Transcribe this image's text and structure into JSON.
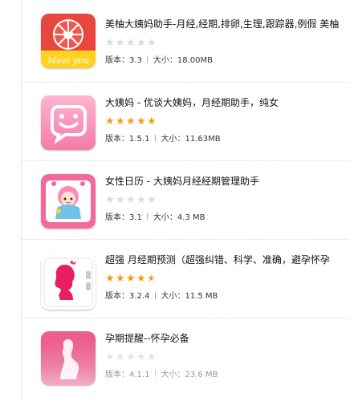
{
  "apps": [
    {
      "title": "美柚大姨妈助手-月经,经期,排卵,生理,跟踪器,例假 美柚",
      "stars": [
        0,
        0,
        0,
        0,
        0
      ],
      "version_label": "版本：",
      "version": "3.3",
      "size_label": "大小：",
      "size": "18.00MB",
      "icon": "meetyou-grapefruit-icon",
      "icon_text": "Meet you"
    },
    {
      "title": "大姨妈 - 优谈大姨妈，月经期助手，纯女",
      "stars": [
        1,
        1,
        1,
        1,
        1
      ],
      "version_label": "版本：",
      "version": "1.5.1",
      "size_label": "大小：",
      "size": "11.63MB",
      "icon": "smiley-speech-bubble-icon"
    },
    {
      "title": "女性日历 - 大姨妈月经经期管理助手",
      "stars": [
        0,
        0,
        0,
        0,
        0
      ],
      "version_label": "版本：",
      "version": "3.1",
      "size_label": "大小：",
      "size": "4.3 MB",
      "icon": "cartoon-girl-calendar-icon"
    },
    {
      "title": "超强 月经期预测（超强纠错、科学、准确，避孕怀孕",
      "stars": [
        1,
        1,
        1,
        1,
        0.5
      ],
      "version_label": "版本：",
      "version": "3.2.4",
      "size_label": "大小：",
      "size": "11.5 MB",
      "icon": "woman-silhouette-notebook-icon"
    },
    {
      "title": "孕期提醒--怀孕必备",
      "stars": [
        0,
        0,
        0,
        0,
        0
      ],
      "version_label": "版本：",
      "version": "4.1.1",
      "size_label": "大小：",
      "size": "23.6 MB",
      "icon": "pregnant-silhouette-icon"
    }
  ],
  "colors": {
    "star_on": "#f39c12",
    "star_off": "#d6dbe1",
    "meetyou_red": "#e8473f",
    "meetyou_yellow": "#ffd21f",
    "pink": "#f47aa8"
  }
}
